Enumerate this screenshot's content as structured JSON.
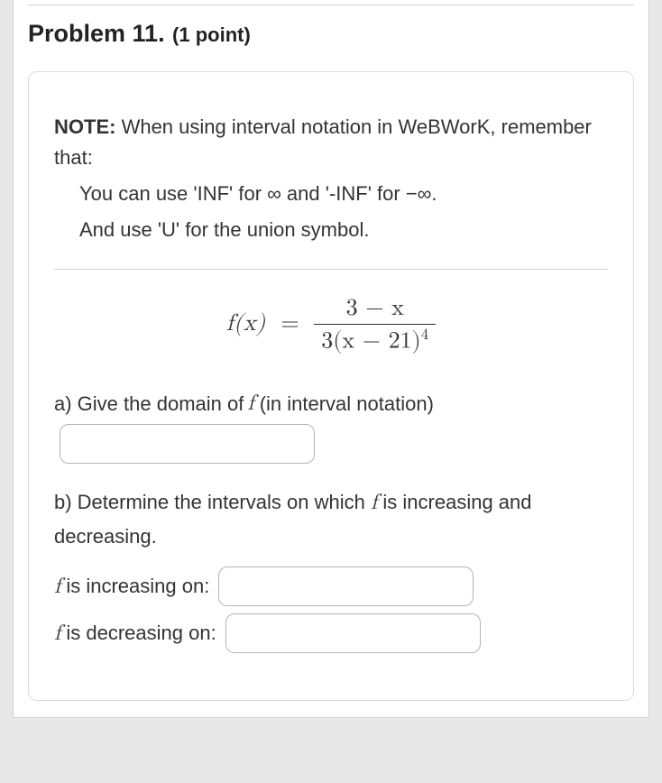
{
  "header": {
    "title": "Problem 11.",
    "points": "(1 point)"
  },
  "note": {
    "label": "NOTE:",
    "line1_rest": " When using interval notation in WeBWorK, remember that:",
    "line2": "You can use 'INF' for ∞ and '-INF' for −∞.",
    "line3": "And use 'U' for the union symbol."
  },
  "equation": {
    "lhs": "f(x)",
    "eq": "=",
    "numerator": "3 − x",
    "denominator_pre": "3(x − 21)",
    "denominator_exp": "4"
  },
  "parts": {
    "a": {
      "text_pre": "a) Give the domain of ",
      "f": "f",
      "text_post": " (in interval notation)"
    },
    "b": {
      "intro_pre": "b) Determine the intervals on which ",
      "f": "f",
      "intro_post": " is increasing and decreasing.",
      "inc_pre_f": "f",
      "inc_text": " is increasing on:",
      "dec_pre_f": "f",
      "dec_text": " is decreasing on:"
    }
  }
}
